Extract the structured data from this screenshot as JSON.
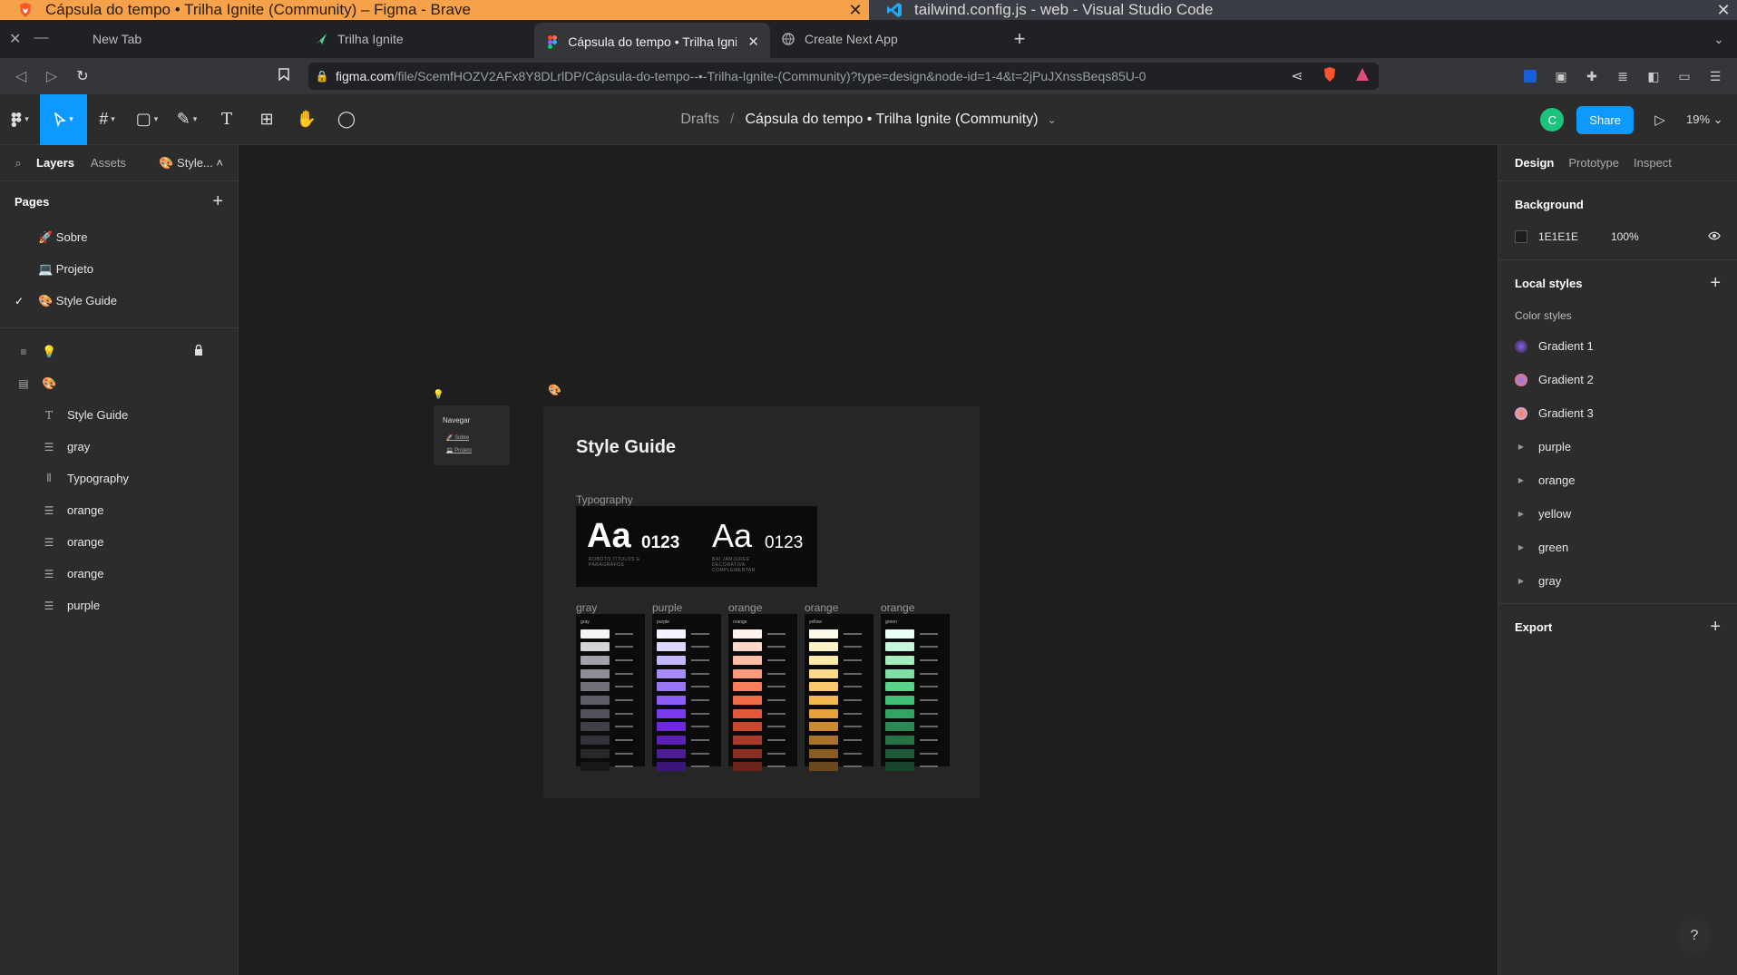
{
  "os_windows": [
    {
      "title": "Cápsula do tempo • Trilha Ignite (Community) – Figma - Brave",
      "active": true
    },
    {
      "title": "tailwind.config.js - web - Visual Studio Code",
      "active": false
    }
  ],
  "browser": {
    "tabs": [
      {
        "label": "New Tab",
        "active": false
      },
      {
        "label": "Trilha Ignite",
        "active": false
      },
      {
        "label": "Cápsula do tempo • Trilha Ignit",
        "active": true
      },
      {
        "label": "Create Next App",
        "active": false
      }
    ],
    "url_host": "figma.com",
    "url_path": "/file/ScemfHOZV2AFx8Y8DLrlDP/Cápsula-do-tempo--•-Trilha-Ignite-(Community)?type=design&node-id=1-4&t=2jPuJXnssBeqs85U-0",
    "brave_badge": "3"
  },
  "figma": {
    "breadcrumb": {
      "drafts": "Drafts",
      "sep": "/",
      "file": "Cápsula do tempo • Trilha Ignite (Community)"
    },
    "avatar_initial": "C",
    "share_label": "Share",
    "zoom": "19%",
    "left": {
      "tabs": {
        "layers": "Layers",
        "assets": "Assets",
        "style": "🎨 Style..."
      },
      "pages_title": "Pages",
      "pages": [
        {
          "label": "🚀 Sobre",
          "current": false
        },
        {
          "label": "💻 Projeto",
          "current": false
        },
        {
          "label": "🎨 Style Guide",
          "current": true
        }
      ],
      "layers": [
        {
          "label": "💡",
          "icon": "frame-list-icon",
          "top": true,
          "locked": true
        },
        {
          "label": "🎨",
          "icon": "frame-icon",
          "top": true,
          "locked": false
        },
        {
          "label": "Style Guide",
          "icon": "text-icon"
        },
        {
          "label": "gray",
          "icon": "autolayout-icon"
        },
        {
          "label": "Typography",
          "icon": "columns-icon"
        },
        {
          "label": "orange",
          "icon": "autolayout-icon"
        },
        {
          "label": "orange",
          "icon": "autolayout-icon"
        },
        {
          "label": "orange",
          "icon": "autolayout-icon"
        },
        {
          "label": "purple",
          "icon": "autolayout-icon"
        }
      ]
    },
    "canvas": {
      "nav_frame": {
        "title": "Navegar",
        "links": [
          "🚀 Sobre",
          "💻 Projeto"
        ]
      },
      "style_guide": {
        "title": "Style Guide",
        "typography_label": "Typography",
        "font1": {
          "aa": "Aa",
          "nums": "0123",
          "caption": "ROBOTO TÍTULOS E PARÁGRAFOS"
        },
        "font2": {
          "aa": "Aa",
          "nums": "0123",
          "caption": "BAI JAMJUREE DECORATIVA COMPLEMENTAR"
        },
        "swatches": [
          {
            "label": "gray",
            "header": "gray",
            "colors": [
              "#f4f4f5",
              "#d4d4d8",
              "#a1a1aa",
              "#8e8e96",
              "#71717a",
              "#5d5d66",
              "#52525b",
              "#3f3f46",
              "#323238",
              "#27272a",
              "#18181b"
            ]
          },
          {
            "label": "purple",
            "header": "purple",
            "colors": [
              "#f5f3ff",
              "#ddd6fe",
              "#c4b5fd",
              "#a78bfa",
              "#9775f5",
              "#8b5cf6",
              "#7c3aed",
              "#6d28d9",
              "#5b21b6",
              "#4c1d95",
              "#3b1578"
            ]
          },
          {
            "label": "orange",
            "header": "orange",
            "colors": [
              "#fff1ec",
              "#fed7c8",
              "#fdbca6",
              "#fb9b7b",
              "#f7805a",
              "#ef6b43",
              "#e3583a",
              "#c9472e",
              "#a93a27",
              "#8a2f22",
              "#6b241b"
            ]
          },
          {
            "label": "orange",
            "header": "yellow",
            "colors": [
              "#fffbea",
              "#fef3c7",
              "#fde9a8",
              "#fcd889",
              "#f9c86c",
              "#f4b64f",
              "#e4a13c",
              "#c98a32",
              "#a9722b",
              "#8a5d25",
              "#6b481d"
            ]
          },
          {
            "label": "orange",
            "header": "green",
            "colors": [
              "#ecfdf3",
              "#c7f5d9",
              "#a3ecc0",
              "#7ee0a4",
              "#5bd18b",
              "#3fbf75",
              "#33a563",
              "#2b8a53",
              "#247145",
              "#1d5a38",
              "#16442b"
            ]
          }
        ]
      }
    },
    "right": {
      "tabs": [
        "Design",
        "Prototype",
        "Inspect"
      ],
      "background": {
        "title": "Background",
        "hex": "1E1E1E",
        "opacity": "100%"
      },
      "local_styles": {
        "title": "Local styles",
        "color_styles_label": "Color styles",
        "gradients": [
          {
            "label": "Gradient 1",
            "colors": [
              "#8b5cf6",
              "#2a2a2a"
            ]
          },
          {
            "label": "Gradient 2",
            "colors": [
              "#9775f5",
              "#f7805a"
            ]
          },
          {
            "label": "Gradient 3",
            "colors": [
              "#f7805a",
              "#c4b5fd"
            ]
          }
        ],
        "groups": [
          "purple",
          "orange",
          "yellow",
          "green",
          "gray"
        ]
      },
      "export_title": "Export"
    },
    "help": "?"
  },
  "colors": {
    "accent": "#0d99ff",
    "title_active": "#f5a24b",
    "canvas": "#1e1e1e"
  }
}
